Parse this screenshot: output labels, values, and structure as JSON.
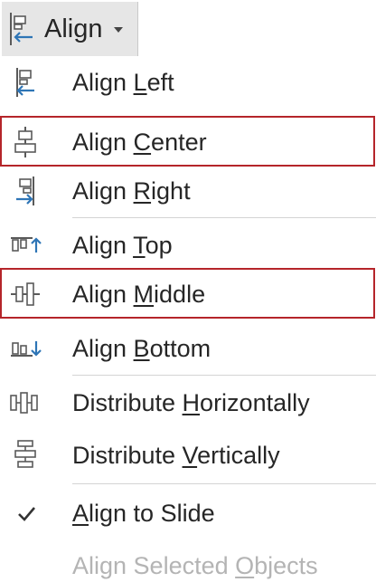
{
  "button": {
    "label": "Align",
    "icon": "align-left-icon"
  },
  "menu": {
    "items": [
      {
        "pre": "Align ",
        "key": "L",
        "post": "eft",
        "icon": "align-left-icon",
        "highlighted": false
      },
      {
        "pre": "Align ",
        "key": "C",
        "post": "enter",
        "icon": "align-center-icon",
        "highlighted": true
      },
      {
        "pre": "Align ",
        "key": "R",
        "post": "ight",
        "icon": "align-right-icon",
        "highlighted": false
      },
      {
        "pre": "Align ",
        "key": "T",
        "post": "op",
        "icon": "align-top-icon",
        "highlighted": false
      },
      {
        "pre": "Align ",
        "key": "M",
        "post": "iddle",
        "icon": "align-middle-icon",
        "highlighted": true
      },
      {
        "pre": "Align ",
        "key": "B",
        "post": "ottom",
        "icon": "align-bottom-icon",
        "highlighted": false
      },
      {
        "pre": "Distribute ",
        "key": "H",
        "post": "orizontally",
        "icon": "distribute-horizontally-icon",
        "highlighted": false
      },
      {
        "pre": "Distribute ",
        "key": "V",
        "post": "ertically",
        "icon": "distribute-vertically-icon",
        "highlighted": false
      },
      {
        "pre": "",
        "key": "A",
        "post": "lign to Slide",
        "icon": "check-icon",
        "checked": true,
        "highlighted": false
      },
      {
        "pre": "Align Selected ",
        "key": "O",
        "post": "bjects",
        "icon": "",
        "disabled": true,
        "highlighted": false
      }
    ]
  },
  "colors": {
    "highlight_border": "#b5252a",
    "arrow_blue": "#2e75b6",
    "disabled_text": "#b4b4b4"
  }
}
